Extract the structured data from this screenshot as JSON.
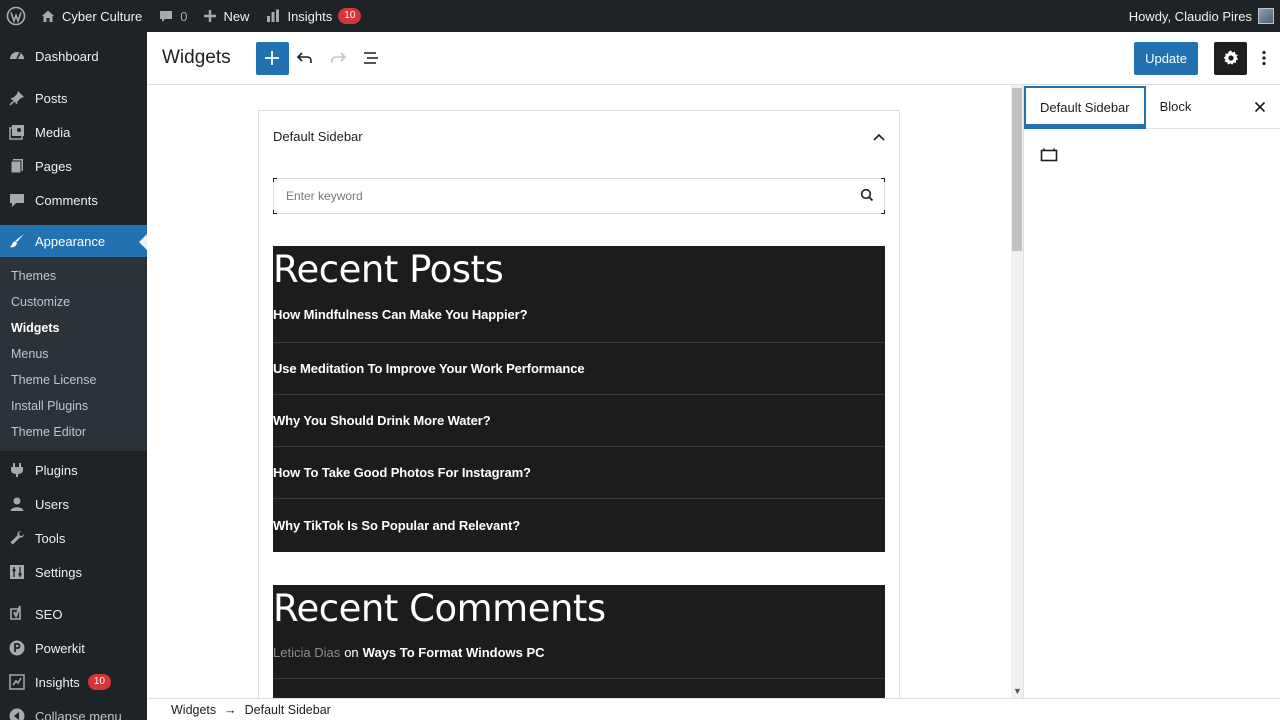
{
  "adminbar": {
    "site_name": "Cyber Culture",
    "comments_count": "0",
    "new_label": "New",
    "insights_label": "Insights",
    "insights_badge": "10",
    "greeting": "Howdy, Claudio Pires"
  },
  "menu": {
    "dashboard": "Dashboard",
    "posts": "Posts",
    "media": "Media",
    "pages": "Pages",
    "comments": "Comments",
    "appearance": "Appearance",
    "appearance_sub": [
      "Themes",
      "Customize",
      "Widgets",
      "Menus",
      "Theme License",
      "Install Plugins",
      "Theme Editor"
    ],
    "plugins": "Plugins",
    "users": "Users",
    "tools": "Tools",
    "settings": "Settings",
    "seo": "SEO",
    "powerkit": "Powerkit",
    "insights": "Insights",
    "insights_badge": "10",
    "collapse": "Collapse menu"
  },
  "header": {
    "title": "Widgets",
    "update_label": "Update"
  },
  "widget_area": {
    "title": "Default Sidebar",
    "search_placeholder": "Enter keyword",
    "recent_posts": {
      "title": "Recent Posts",
      "items": [
        "How Mindfulness Can Make You Happier?",
        "Use Meditation To Improve Your Work Performance",
        "Why You Should Drink More Water?",
        "How To Take Good Photos For Instagram?",
        "Why TikTok Is So Popular and Relevant?"
      ]
    },
    "recent_comments": {
      "title": "Recent Comments",
      "items": [
        {
          "author": "Leticia Dias",
          "on": "on",
          "post": "Ways To Format Windows PC"
        }
      ]
    }
  },
  "settings_panel": {
    "tab_area": "Default Sidebar",
    "tab_block": "Block"
  },
  "footer": {
    "crumb_root": "Widgets",
    "separator": "→",
    "crumb_current": "Default Sidebar"
  },
  "colors": {
    "admin_dark": "#1d2327",
    "accent": "#2271b1",
    "badge": "#d63638",
    "widget_dark": "#1c1c1c"
  }
}
